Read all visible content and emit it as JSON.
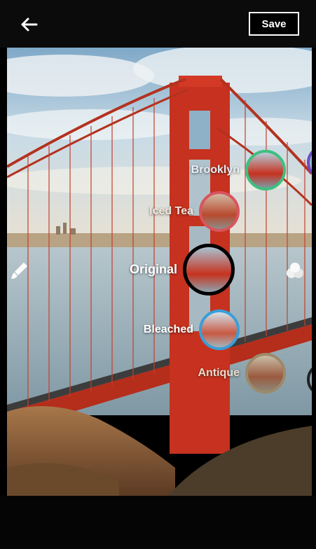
{
  "toolbar": {
    "back_icon": "arrow-left-icon",
    "save_label": "Save"
  },
  "filters": [
    {
      "id": "brooklyn",
      "label": "Brooklyn",
      "ring_color": "#3fbf7f"
    },
    {
      "id": "iced-tea",
      "label": "Iced Tea",
      "ring_color": "#d9545e"
    },
    {
      "id": "original",
      "label": "Original",
      "ring_color": "#000000",
      "selected": true
    },
    {
      "id": "bleached",
      "label": "Bleached",
      "ring_color": "#3a9ed8"
    },
    {
      "id": "antique",
      "label": "Antique",
      "ring_color": "#9c8a6a"
    }
  ],
  "side_icons": {
    "left": "paintbrush-icon",
    "right": "color-circles-icon"
  },
  "colors": {
    "bridge": "#c6321f",
    "sky": "#9ec3db",
    "water": "#9fb3bf"
  }
}
